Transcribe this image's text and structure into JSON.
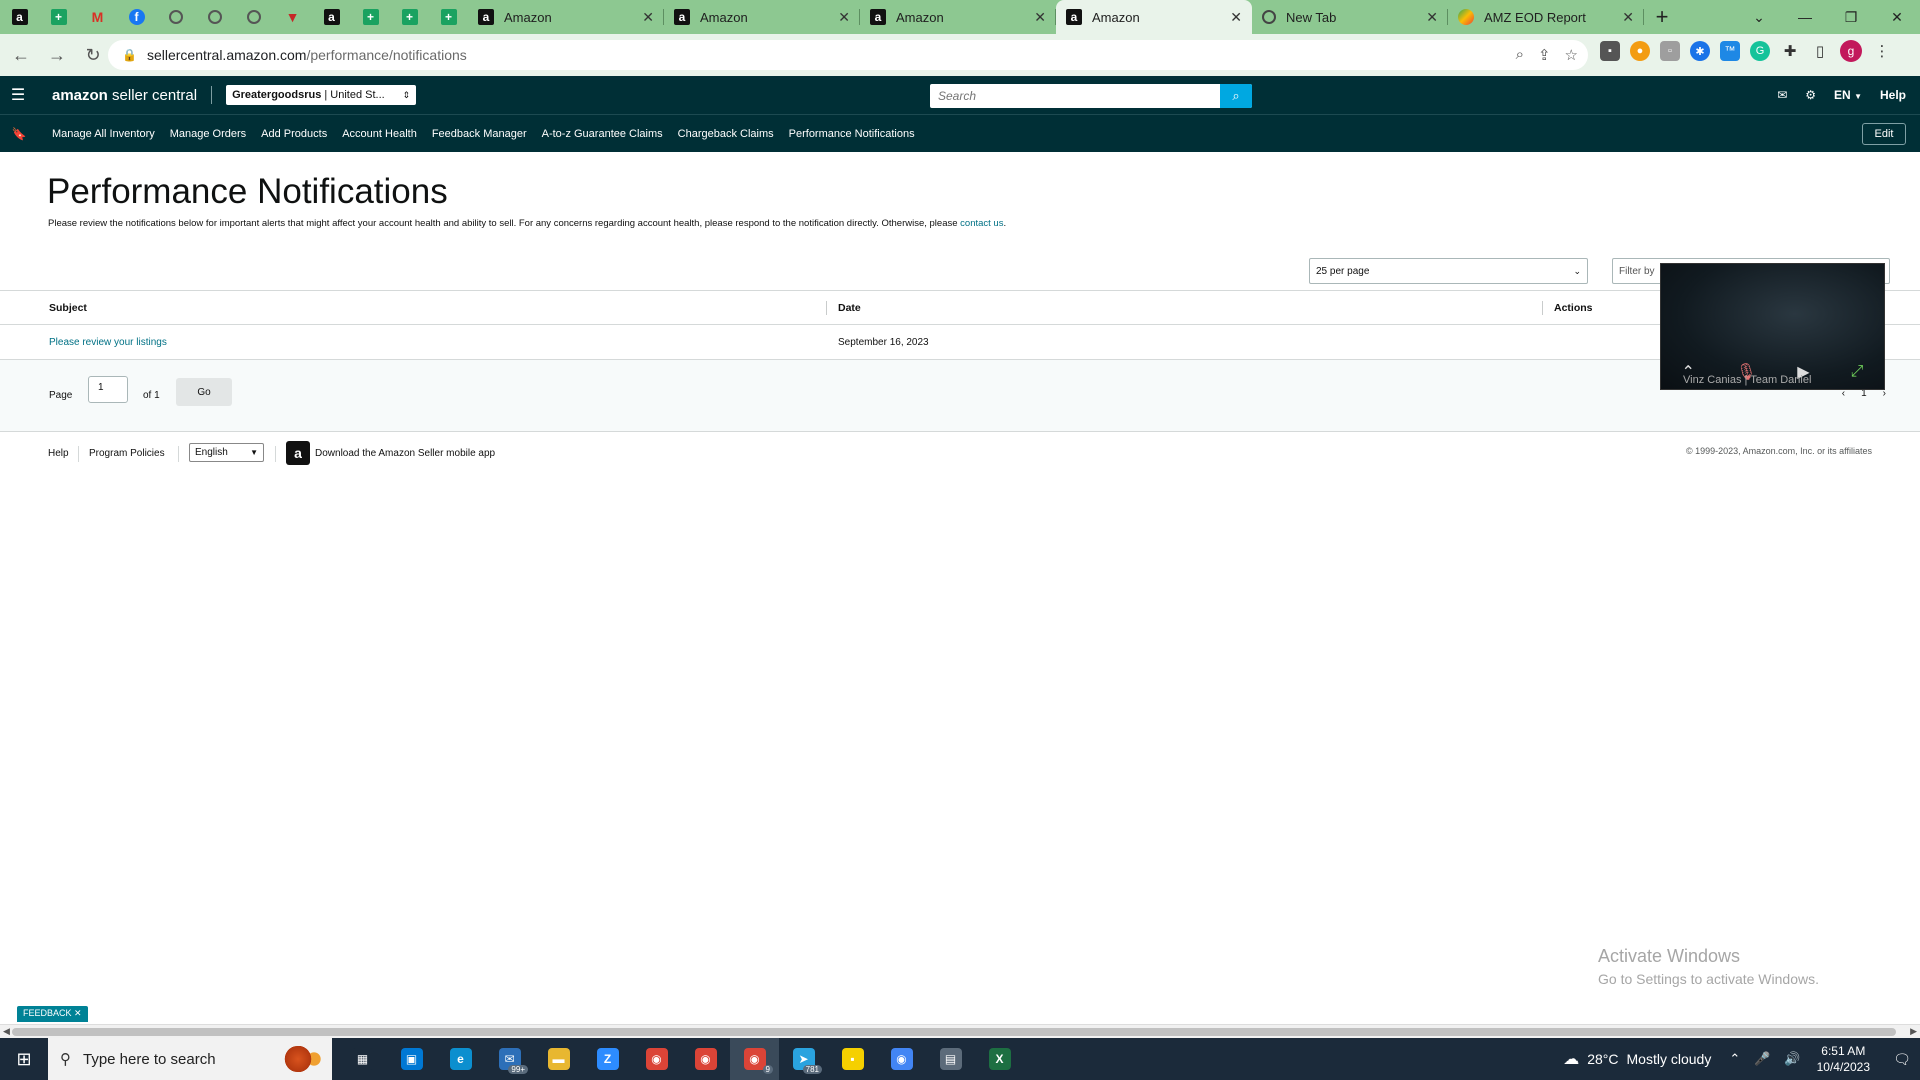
{
  "browser": {
    "pinned_tabs": [
      {
        "icon": "amazon-favicon-icon",
        "glyph": "a",
        "cls": "amz"
      },
      {
        "icon": "sheets-favicon-icon",
        "glyph": "+",
        "cls": "sheet"
      },
      {
        "icon": "gmail-favicon-icon",
        "glyph": "M",
        "cls": "gm"
      },
      {
        "icon": "facebook-favicon-icon",
        "glyph": "f",
        "cls": "fb"
      },
      {
        "icon": "globe-favicon-icon",
        "glyph": "",
        "cls": "globe"
      },
      {
        "icon": "globe-favicon-icon",
        "glyph": "",
        "cls": "globe"
      },
      {
        "icon": "globe-favicon-icon",
        "glyph": "",
        "cls": "globe"
      },
      {
        "icon": "shield-favicon-icon",
        "glyph": "▼",
        "cls": "shield"
      },
      {
        "icon": "amazon-favicon-icon",
        "glyph": "a",
        "cls": "amz"
      },
      {
        "icon": "sheets-favicon-icon",
        "glyph": "+",
        "cls": "sheet"
      },
      {
        "icon": "sheets-favicon-icon",
        "glyph": "+",
        "cls": "sheet"
      },
      {
        "icon": "sheets-favicon-icon",
        "glyph": "+",
        "cls": "sheet"
      }
    ],
    "tabs": [
      {
        "label": "Amazon",
        "favicon": "amazon-favicon-icon",
        "active": false
      },
      {
        "label": "Amazon",
        "favicon": "amazon-favicon-icon",
        "active": false
      },
      {
        "label": "Amazon",
        "favicon": "amazon-favicon-icon",
        "active": false
      },
      {
        "label": "Amazon",
        "favicon": "amazon-favicon-icon",
        "active": true
      },
      {
        "label": "New Tab",
        "favicon": "chrome-favicon-icon",
        "active": false
      },
      {
        "label": "AMZ EOD Report",
        "favicon": "report-favicon-icon",
        "active": false
      }
    ],
    "url_host": "sellercentral.amazon.com",
    "url_path": "/performance/notifications"
  },
  "header": {
    "logo_bold": "amazon",
    "logo_light": " seller central",
    "store_name": "Greatergoodsrus",
    "store_market": " | United St...",
    "search_placeholder": "Search",
    "language": "EN",
    "help": "Help"
  },
  "nav": {
    "items": [
      "Manage All Inventory",
      "Manage Orders",
      "Add Products",
      "Account Health",
      "Feedback Manager",
      "A-to-z Guarantee Claims",
      "Chargeback Claims",
      "Performance Notifications"
    ],
    "edit": "Edit"
  },
  "main": {
    "title": "Performance Notifications",
    "description": "Please review the notifications below for important alerts that might affect your account health and ability to sell. For any concerns regarding account health, please respond to the notification directly. Otherwise, please ",
    "contact_link": "contact us",
    "description_end": ".",
    "per_page": "25 per page",
    "filter_placeholder": "Filter by",
    "columns": {
      "subject": "Subject",
      "date": "Date",
      "actions": "Actions"
    },
    "rows": [
      {
        "subject": "Please review your listings",
        "date": "September 16, 2023"
      }
    ],
    "pager": {
      "page_label": "Page",
      "page_value": "1",
      "of_label": "of 1",
      "go": "Go",
      "current": "1"
    }
  },
  "footer": {
    "help": "Help",
    "program_policies": "Program Policies",
    "language": "English",
    "download_app": "Download the Amazon Seller mobile app",
    "copyright": "© 1999-2023, Amazon.com, Inc. or its affiliates"
  },
  "video_overlay": {
    "participant": "Vinz Canias | Team Daniel"
  },
  "watermark": {
    "line1": "Activate Windows",
    "line2": "Go to Settings to activate Windows."
  },
  "feedback": "FEEDBACK",
  "taskbar": {
    "search_placeholder": "Type here to search",
    "apps": [
      {
        "name": "task-view-icon",
        "glyph": "▦",
        "color": "#1b2a3a"
      },
      {
        "name": "store-icon",
        "glyph": "▣",
        "color": "#0078d4"
      },
      {
        "name": "edge-icon",
        "glyph": "e",
        "color": "#0c8fcf"
      },
      {
        "name": "mail-icon",
        "glyph": "✉",
        "color": "#2d6fb8",
        "badge": "99+"
      },
      {
        "name": "file-explorer-icon",
        "glyph": "▬",
        "color": "#e8b730"
      },
      {
        "name": "zoom-icon",
        "glyph": "Z",
        "color": "#2d8cff"
      },
      {
        "name": "chrome-icon",
        "glyph": "◉",
        "color": "#db4437"
      },
      {
        "name": "chrome-profile-icon",
        "glyph": "◉",
        "color": "#db4437"
      },
      {
        "name": "chrome-active-icon",
        "glyph": "◉",
        "color": "#db4437",
        "badge": "9",
        "active": true
      },
      {
        "name": "telegram-icon",
        "glyph": "➤",
        "color": "#2aa3df",
        "badge": "781"
      },
      {
        "name": "sticky-notes-icon",
        "glyph": "▪",
        "color": "#f5d000"
      },
      {
        "name": "chrome-alt-icon",
        "glyph": "◉",
        "color": "#4285f4"
      },
      {
        "name": "calculator-icon",
        "glyph": "▤",
        "color": "#5c6b7a"
      },
      {
        "name": "excel-icon",
        "glyph": "X",
        "color": "#1d6f42"
      }
    ],
    "weather_temp": "28°C",
    "weather_desc": "Mostly cloudy",
    "time": "6:51 AM",
    "date": "10/4/2023",
    "notifications": "1"
  },
  "colors": {
    "header_bg": "#002f36",
    "link": "#007185",
    "tabstrip": "#8dc891",
    "search_btn": "#00a8e1"
  }
}
